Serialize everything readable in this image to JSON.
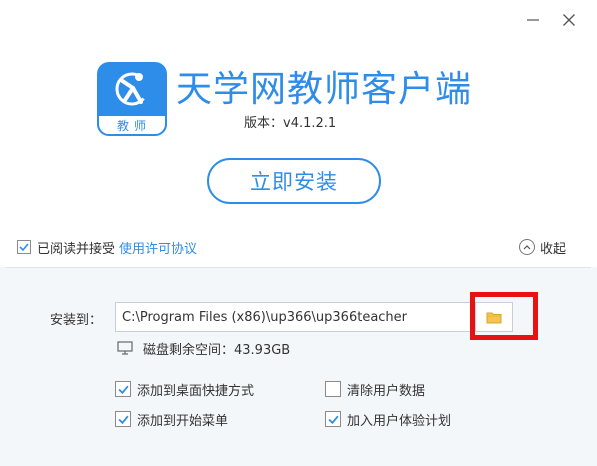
{
  "window": {
    "minimize_icon": "minimize-icon",
    "close_icon": "close-icon"
  },
  "header": {
    "logo_text": "教师",
    "app_title": "天学网教师客户端",
    "version": "版本：v4.1.2.1"
  },
  "install_button": "立即安装",
  "agreement": {
    "checked": true,
    "text": "已阅读并接受",
    "link": "使用许可协议"
  },
  "collapse": {
    "label": "收起",
    "icon": "chevron-up-icon"
  },
  "install_path": {
    "label": "安装到：",
    "value": "C:\\Program Files (x86)\\up366\\up366teacher",
    "browse_icon": "folder-icon"
  },
  "disk": {
    "icon": "monitor-icon",
    "text": "磁盘剩余空间：43.93GB"
  },
  "options": [
    {
      "label": "添加到桌面快捷方式",
      "checked": true
    },
    {
      "label": "清除用户数据",
      "checked": false
    },
    {
      "label": "添加到开始菜单",
      "checked": true
    },
    {
      "label": "加入用户体验计划",
      "checked": true
    }
  ],
  "colors": {
    "accent": "#2f8dea",
    "highlight": "#e81212",
    "panel_bg": "#f4f7fa"
  }
}
